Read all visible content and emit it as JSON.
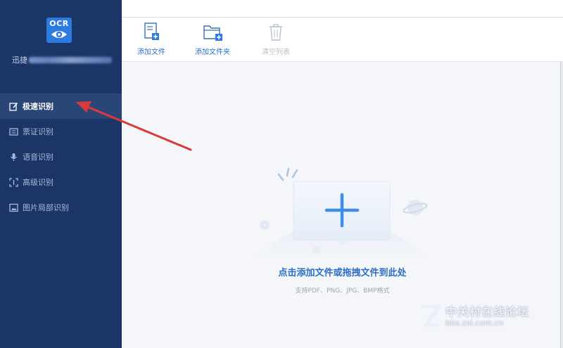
{
  "app": {
    "logo_text": "OCR",
    "user_name": "迅捷"
  },
  "sidebar": {
    "items": [
      {
        "label": "极速识别",
        "active": true
      },
      {
        "label": "票证识别"
      },
      {
        "label": "语音识别"
      },
      {
        "label": "高级识别"
      },
      {
        "label": "图片局部识别"
      }
    ]
  },
  "toolbar": {
    "add_file": "添加文件",
    "add_folder": "添加文件夹",
    "clear_list": "清空列表"
  },
  "dropzone": {
    "hint": "点击添加文件或拖拽文件到此处",
    "formats": "支持PDF、PNG、JPG、BMP格式"
  },
  "watermark": {
    "site": "中关村在线论坛",
    "url": "bbs.zol.com.cn"
  },
  "colors": {
    "sidebar": "#1b3566",
    "accent": "#2b7be0",
    "link": "#2a6ec5",
    "annotation": "#d93a3a"
  }
}
